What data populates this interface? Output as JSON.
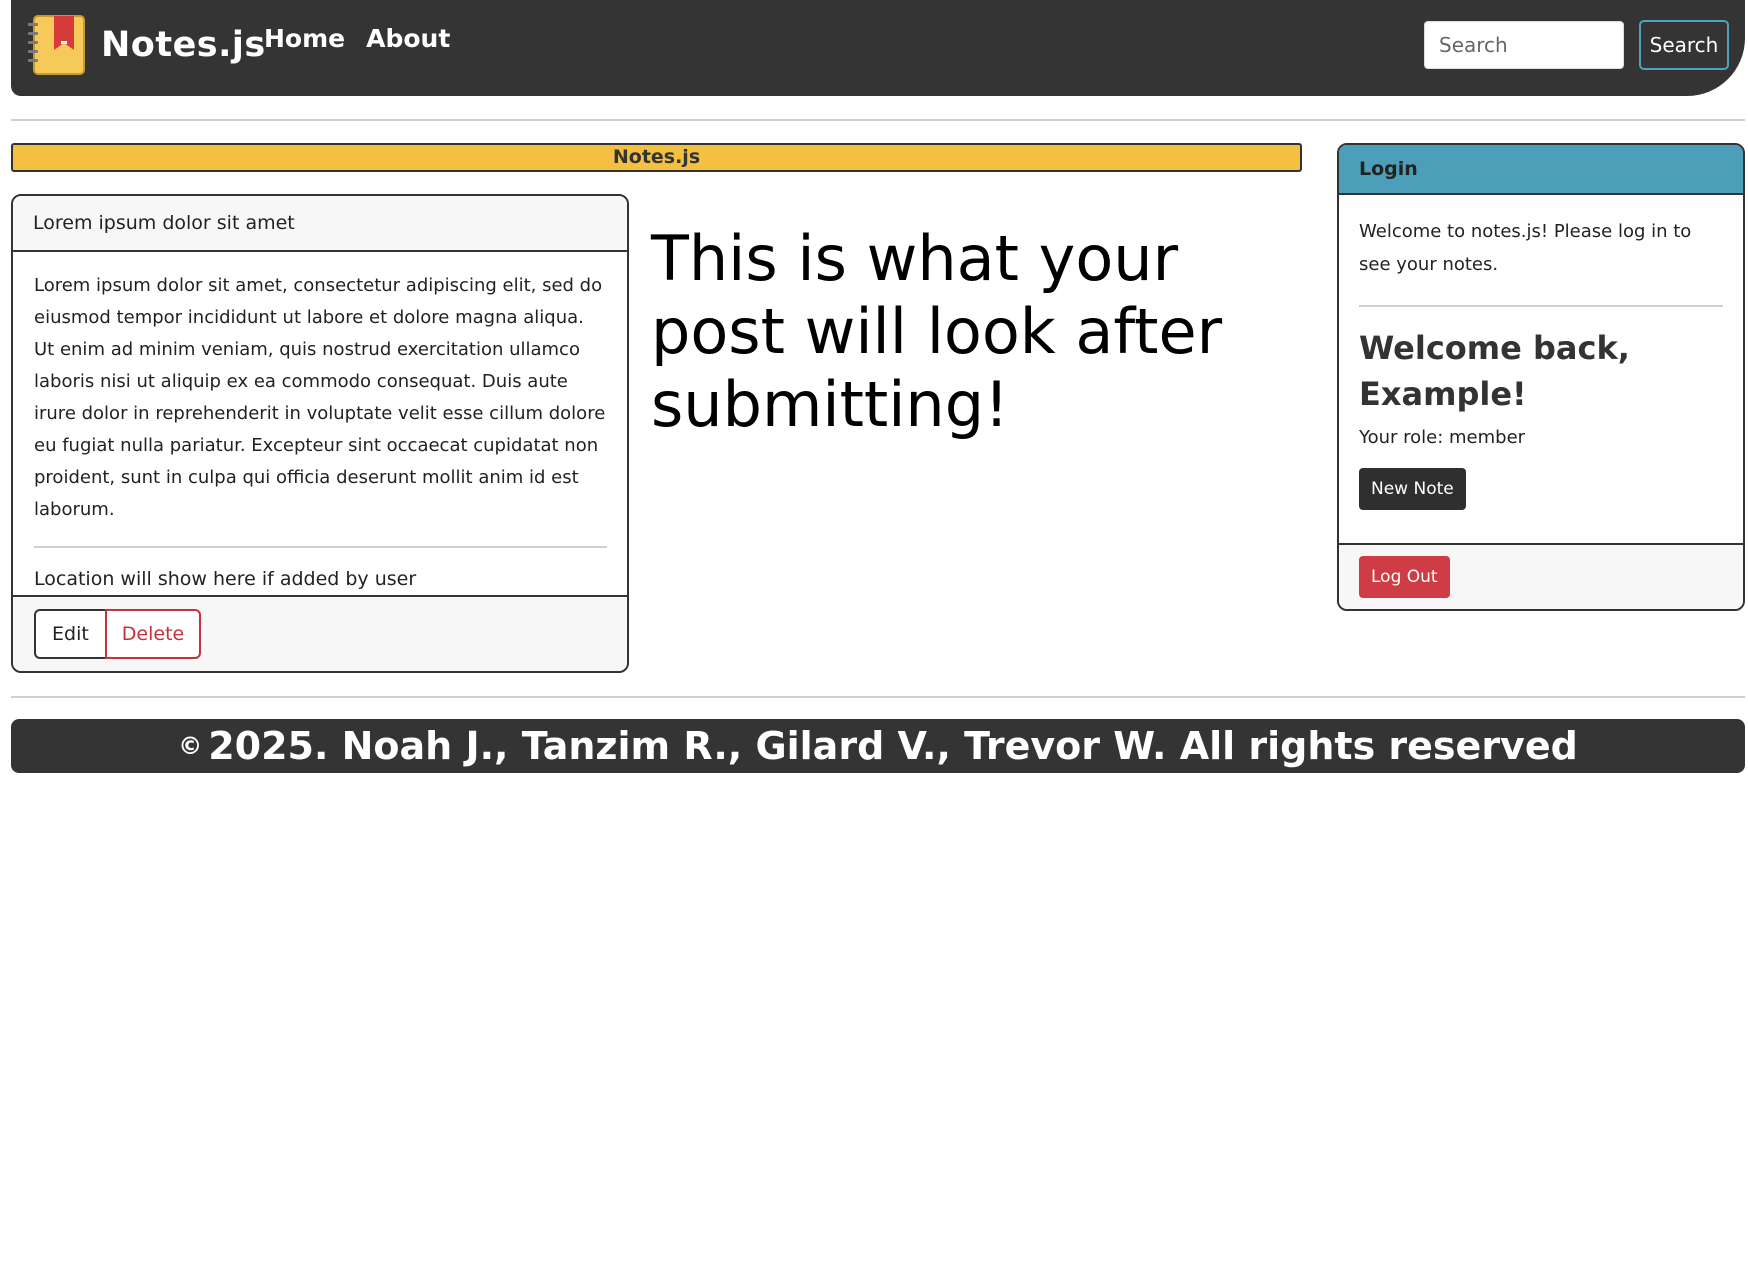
{
  "navbar": {
    "brand": "Notes.js",
    "links": [
      {
        "label": "Home"
      },
      {
        "label": "About"
      }
    ],
    "search_placeholder": "Search",
    "search_button": "Search"
  },
  "title_bar": "Notes.js",
  "note": {
    "title": "Lorem ipsum dolor sit amet",
    "body": "Lorem ipsum dolor sit amet, consectetur adipiscing elit, sed do eiusmod tempor incididunt ut labore et dolore magna aliqua. Ut enim ad minim veniam, quis nostrud exercitation ullamco laboris nisi ut aliquip ex ea commodo consequat. Duis aute irure dolor in reprehenderit in voluptate velit esse cillum dolore eu fugiat nulla pariatur. Excepteur sint occaecat cupidatat non proident, sunt in culpa qui officia deserunt mollit anim id est laborum.",
    "location": "Location will show here if added by user",
    "edit_label": "Edit",
    "delete_label": "Delete"
  },
  "preview_heading": "This is what your post will look after submitting!",
  "login": {
    "header": "Login",
    "intro": "Welcome to notes.js! Please log in to see your notes.",
    "welcome": "Welcome back, Example!",
    "role": "Your role: member",
    "new_note_label": "New Note",
    "logout_label": "Log Out"
  },
  "footer": {
    "copyright_symbol": "©",
    "text": "2025. Noah J., Tanzim R., Gilard V., Trevor W. All rights reserved"
  },
  "colors": {
    "navbar_bg": "#343434",
    "title_bar_bg": "#f4c041",
    "login_header_bg": "#4d9fb9",
    "danger": "#c8303b"
  }
}
